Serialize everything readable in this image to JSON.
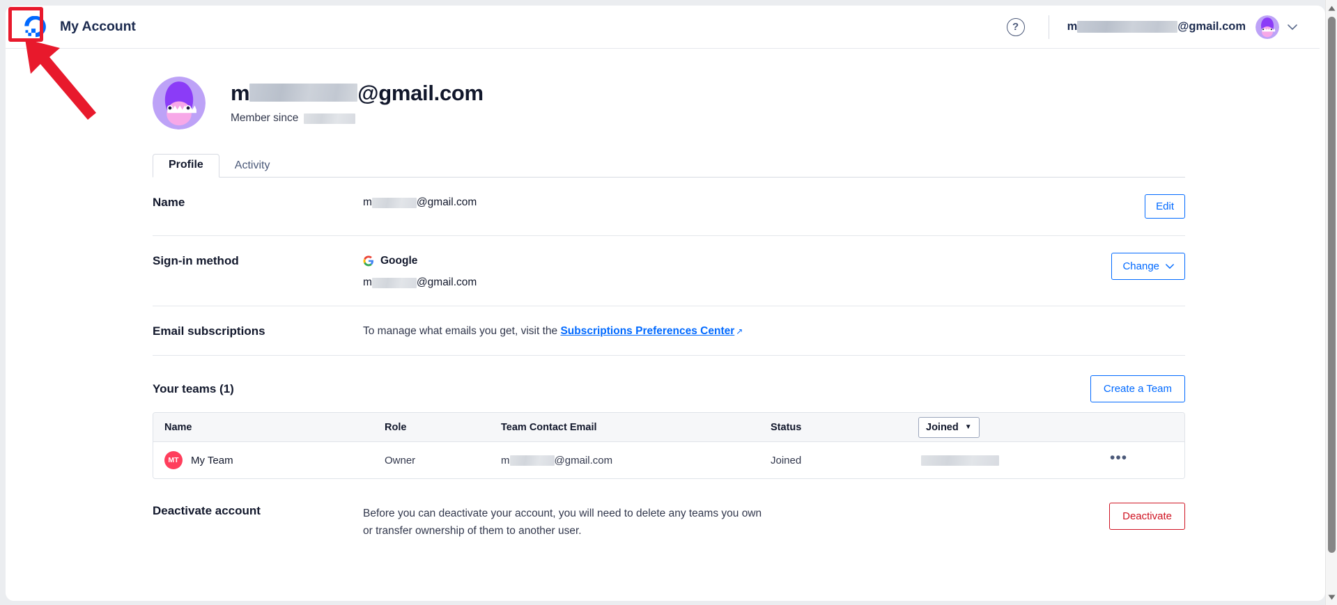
{
  "topbar": {
    "app_title": "My Account",
    "logo_icon": "digitalocean-logo-icon",
    "help_icon": "help-question-icon",
    "account_email_prefix": "m",
    "account_email_suffix": "@gmail.com",
    "avatar_icon": "shark-avatar-icon",
    "chevron_icon": "chevron-down-icon"
  },
  "profile": {
    "email_prefix": "m",
    "email_suffix": "@gmail.com",
    "member_since_label": "Member since",
    "avatar_icon": "shark-avatar-icon"
  },
  "tabs": [
    {
      "label": "Profile",
      "active": true
    },
    {
      "label": "Activity",
      "active": false
    }
  ],
  "fields": {
    "name": {
      "label": "Name",
      "value_prefix": "m",
      "value_suffix": "@gmail.com",
      "action_label": "Edit"
    },
    "signin": {
      "label": "Sign-in method",
      "provider": "Google",
      "provider_icon": "google-g-icon",
      "email_prefix": "m",
      "email_suffix": "@gmail.com",
      "action_label": "Change",
      "action_icon": "chevron-down-icon"
    },
    "email_subscriptions": {
      "label": "Email subscriptions",
      "text_before": "To manage what emails you get, visit the ",
      "link_text": "Subscriptions Preferences Center",
      "link_icon": "external-link-icon"
    }
  },
  "teams": {
    "title": "Your teams (1)",
    "create_button": "Create a Team",
    "columns": {
      "name": "Name",
      "role": "Role",
      "email": "Team Contact Email",
      "status": "Status",
      "joined": "Joined",
      "joined_icon": "caret-down-icon"
    },
    "rows": [
      {
        "badge": "MT",
        "name": "My Team",
        "role": "Owner",
        "email_prefix": "m",
        "email_suffix": "@gmail.com",
        "status": "Joined",
        "joined_date": "",
        "menu_icon": "ellipsis-icon",
        "menu_glyph": "•••"
      }
    ]
  },
  "deactivate": {
    "label": "Deactivate account",
    "line1": "Before you can deactivate your account, you will need to delete any teams you own",
    "line2": "or transfer ownership of them to another user.",
    "button_label": "Deactivate"
  },
  "annotations": {
    "highlight_color": "#e8192c",
    "highlight_target": "digitalocean-logo-icon",
    "arrow_color": "#e8192c"
  },
  "colors": {
    "accent_blue": "#0069ff",
    "danger_red": "#cf1322",
    "title_navy": "#11172b",
    "team_badge": "#ff3e5c"
  },
  "scrollbar": {
    "up_icon": "scroll-up-arrow-icon",
    "down_icon": "scroll-down-arrow-icon"
  }
}
